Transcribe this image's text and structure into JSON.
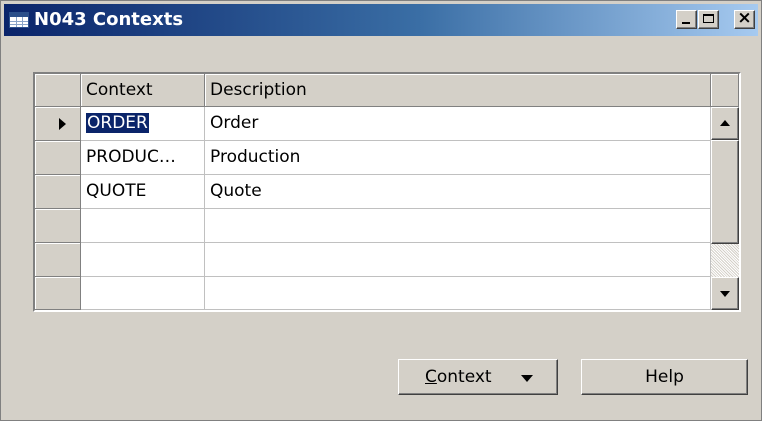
{
  "window": {
    "title": "N043 Contexts",
    "buttons": {
      "minimize": "_",
      "maximize": "□",
      "close": "×"
    }
  },
  "grid": {
    "columns": [
      "Context",
      "Description"
    ],
    "rows": [
      {
        "context": "ORDER",
        "description": "Order",
        "selected": true
      },
      {
        "context": "PRODUC…",
        "description": "Production",
        "selected": false
      },
      {
        "context": "QUOTE",
        "description": "Quote",
        "selected": false
      },
      {
        "context": "",
        "description": "",
        "selected": false
      },
      {
        "context": "",
        "description": "",
        "selected": false
      },
      {
        "context": "",
        "description": "",
        "selected": false
      }
    ]
  },
  "buttons": {
    "context": {
      "accel": "C",
      "rest": "ontext"
    },
    "help": "Help"
  },
  "icons": {
    "window": "table-icon",
    "row_pointer": "current-row-arrow-icon",
    "dropdown": "dropdown-arrow-icon"
  },
  "colors": {
    "title_gradient_start": "#0a246a",
    "title_gradient_end": "#a6caf0",
    "face": "#d4d0c8",
    "selection": "#0a246a"
  }
}
